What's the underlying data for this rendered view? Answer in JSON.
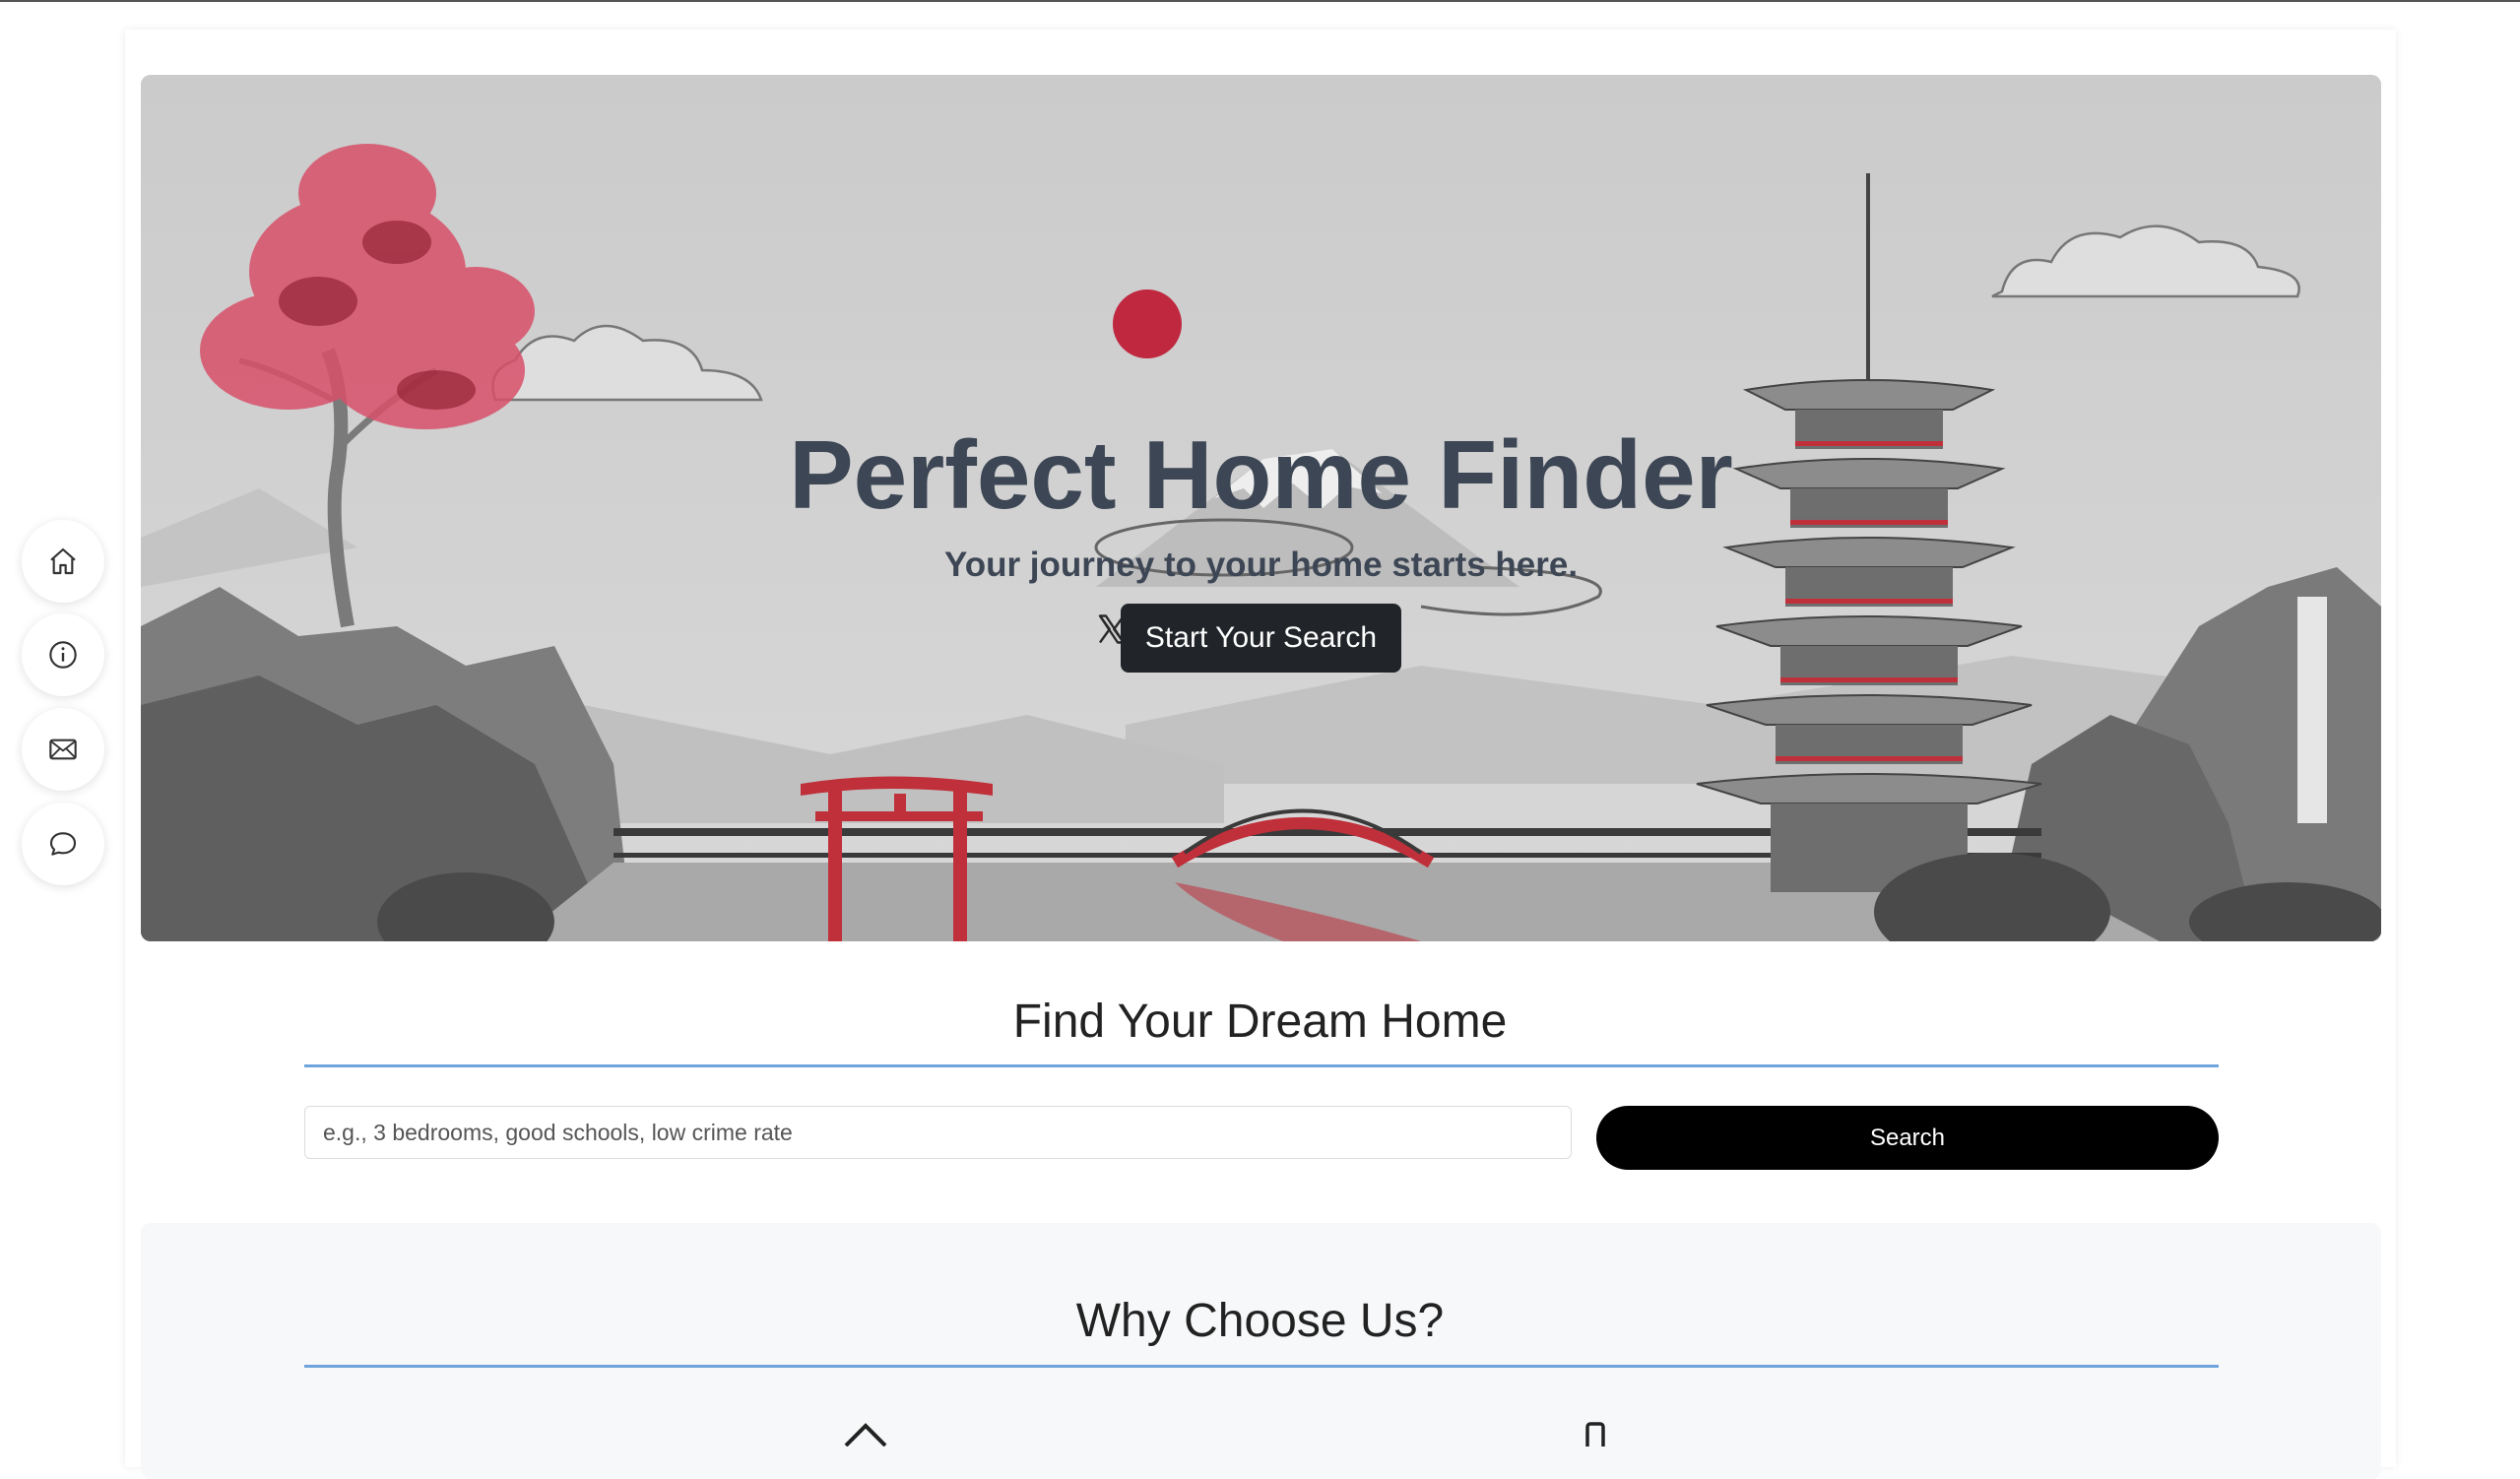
{
  "hero": {
    "title": "Perfect Home Finder",
    "subtitle": "Your journey to your home starts here.",
    "cta_label": "Start Your Search",
    "socials": [
      {
        "icon": "x-twitter-icon"
      },
      {
        "icon": "facebook-icon"
      },
      {
        "icon": "github-icon"
      },
      {
        "icon": "linkedin-icon"
      }
    ]
  },
  "sidebar": {
    "items": [
      {
        "icon": "home-icon"
      },
      {
        "icon": "info-icon"
      },
      {
        "icon": "mail-icon"
      },
      {
        "icon": "chat-icon"
      }
    ]
  },
  "search_section": {
    "title": "Find Your Dream Home",
    "placeholder": "e.g., 3 bedrooms, good schools, low crime rate",
    "button_label": "Search"
  },
  "why_section": {
    "title": "Why Choose Us?"
  },
  "colors": {
    "accent_rule": "#6fa3dc",
    "hero_text": "#3d4654",
    "sun": "#c0283f",
    "torii": "#c0303a"
  }
}
